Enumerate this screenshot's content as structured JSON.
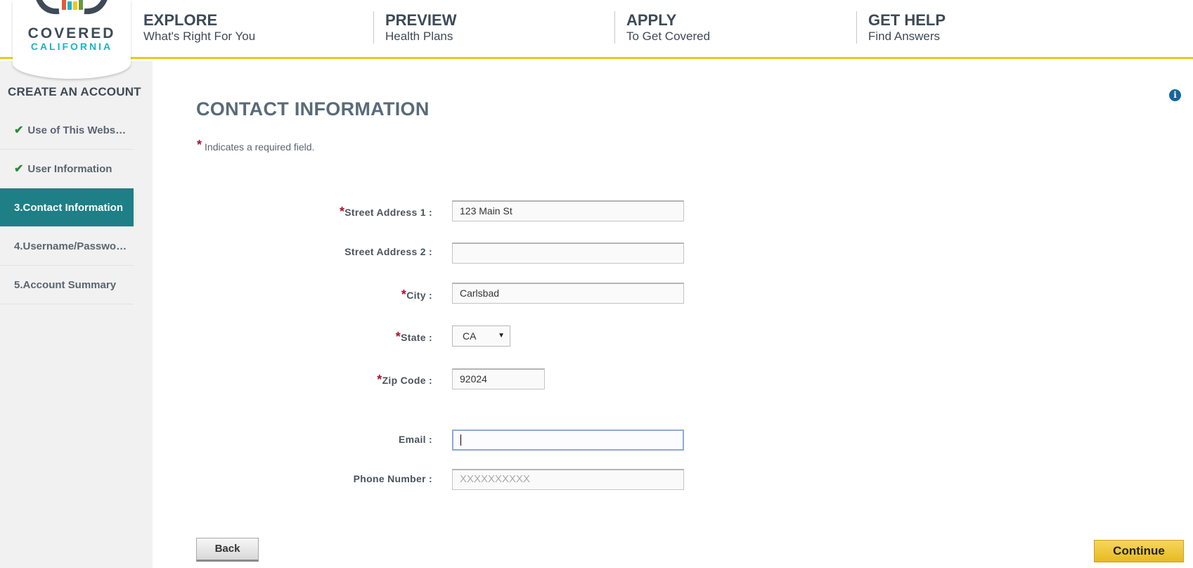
{
  "brand": {
    "line1": "COVERED",
    "line2": "CALIFORNIA",
    "colors": [
      "#e25a37",
      "#1ab3c3",
      "#f2c61f",
      "#6a9a3a",
      "#3e4a56"
    ]
  },
  "nav": [
    {
      "title": "EXPLORE",
      "sub": "What's Right For You"
    },
    {
      "title": "PREVIEW",
      "sub": "Health Plans"
    },
    {
      "title": "APPLY",
      "sub": "To Get Covered"
    },
    {
      "title": "GET HELP",
      "sub": "Find Answers"
    }
  ],
  "sidebar": {
    "title": "CREATE AN ACCOUNT",
    "steps": [
      {
        "label": "Use of This Webs…",
        "status": "complete"
      },
      {
        "label": "User Information",
        "status": "complete"
      },
      {
        "label": "3.Contact Information",
        "status": "active"
      },
      {
        "label": "4.Username/Passwo…",
        "status": "pending"
      },
      {
        "label": "5.Account Summary",
        "status": "pending"
      }
    ]
  },
  "page": {
    "title": "CONTACT INFORMATION",
    "required_star": "*",
    "required_note": "Indicates a required field."
  },
  "form": {
    "street1": {
      "label": "Street Address 1 :",
      "value": "123 Main St",
      "required": true
    },
    "street2": {
      "label": "Street Address 2 :",
      "value": "",
      "required": false
    },
    "city": {
      "label": "City :",
      "value": "Carlsbad",
      "required": true
    },
    "state": {
      "label": "State :",
      "value": "CA",
      "required": true
    },
    "zip": {
      "label": "Zip Code :",
      "value": "92024",
      "required": true
    },
    "email": {
      "label": "Email :",
      "value": "",
      "required": false
    },
    "phone": {
      "label": "Phone Number :",
      "value": "",
      "placeholder": "XXXXXXXXXX",
      "required": false
    }
  },
  "buttons": {
    "back": "Back",
    "continue": "Continue"
  },
  "icons": {
    "check": "✔",
    "info": "i",
    "select_arrow": "▼"
  }
}
